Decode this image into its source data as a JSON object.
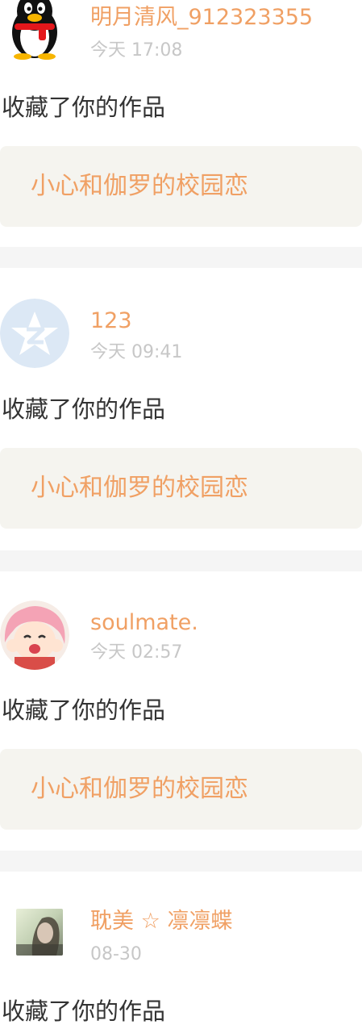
{
  "colors": {
    "accent": "#f0a064",
    "timestamp": "#c7c7c7",
    "action_text": "#333333",
    "work_box_bg": "#f5f4ef",
    "divider_bg": "#f5f5f5"
  },
  "items": [
    {
      "avatar_icon": "qq-penguin-icon",
      "username": "明月清风_912323355",
      "time": "今天 17:08",
      "action": "收藏了你的作品",
      "work_title": "小心和伽罗的校园恋"
    },
    {
      "avatar_icon": "qzone-default-icon",
      "username": "123",
      "time": "今天 09:41",
      "action": "收藏了你的作品",
      "work_title": "小心和伽罗的校园恋"
    },
    {
      "avatar_icon": "anime-girl-icon",
      "username": "soulmate.",
      "time": "今天 02:57",
      "action": "收藏了你的作品",
      "work_title": "小心和伽罗的校园恋"
    },
    {
      "avatar_icon": "photo-avatar-icon",
      "username": "耽美 ☆ 凛凛蝶",
      "time": "08-30",
      "action": "收藏了你的作品"
    }
  ]
}
